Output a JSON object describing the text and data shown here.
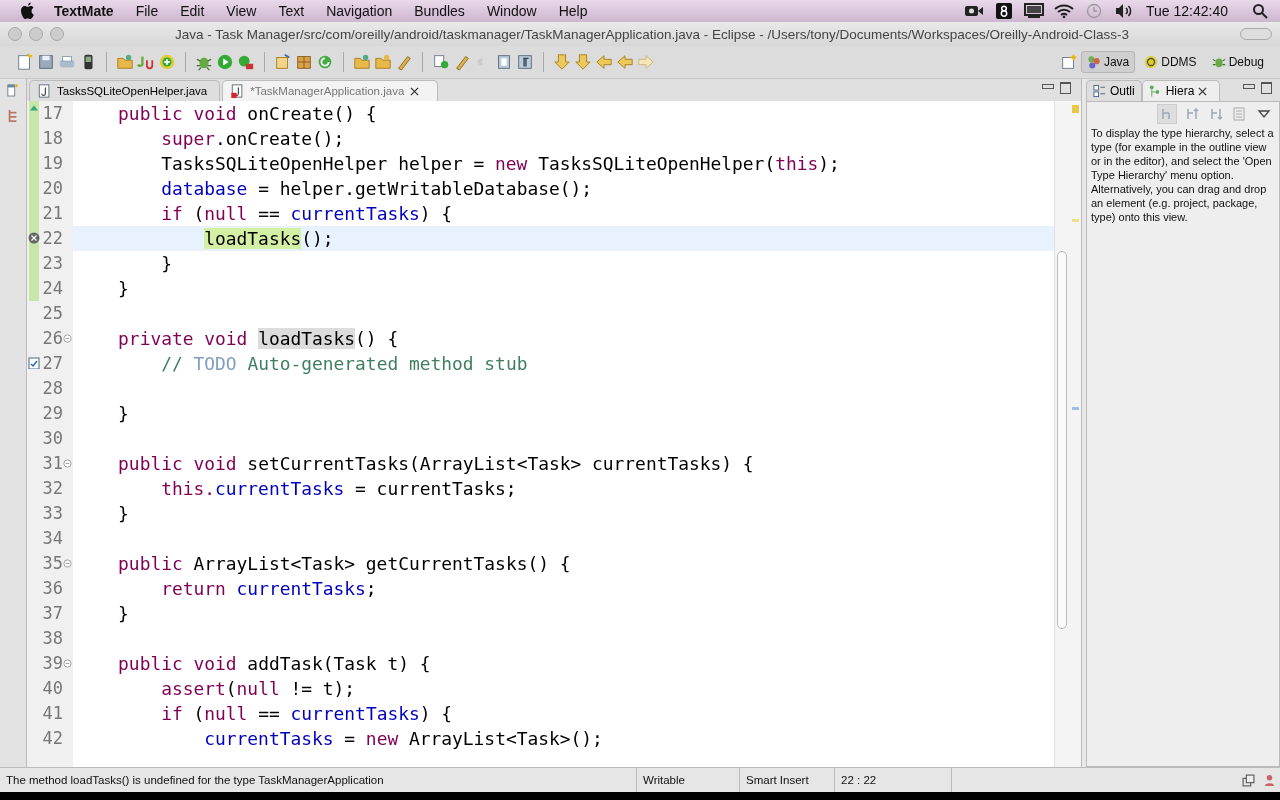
{
  "menu_bar": {
    "app": "TextMate",
    "items": [
      "File",
      "Edit",
      "View",
      "Text",
      "Navigation",
      "Bundles",
      "Window",
      "Help"
    ],
    "clock": "Tue 12:42:40"
  },
  "window": {
    "title": "Java - Task Manager/src/com/oreilly/android/taskmanager/TaskManagerApplication.java - Eclipse - /Users/tony/Documents/Workspaces/Oreilly-Android-Class-3"
  },
  "perspectives": [
    {
      "label": "Java",
      "selected": true
    },
    {
      "label": "DDMS",
      "selected": false
    },
    {
      "label": "Debug",
      "selected": false
    }
  ],
  "editor_tabs": [
    {
      "label": "TasksSQLiteOpenHelper.java",
      "selected": false,
      "closable": false,
      "error": false
    },
    {
      "label": "*TaskManagerApplication.java",
      "selected": true,
      "closable": true,
      "error": true
    }
  ],
  "editor_lines": [
    {
      "number": "17",
      "changed": true,
      "current": false,
      "deletion": true,
      "error": false,
      "task": false,
      "collapsible": false,
      "tokens": [
        {
          "text": "    public void",
          "kind": "keyword"
        },
        {
          "text": " onCreate() {",
          "kind": "plain"
        }
      ]
    },
    {
      "number": "18",
      "changed": true,
      "current": false,
      "deletion": false,
      "error": false,
      "task": false,
      "collapsible": false,
      "tokens": [
        {
          "text": "        super",
          "kind": "keyword"
        },
        {
          "text": ".onCreate();",
          "kind": "plain"
        }
      ]
    },
    {
      "number": "19",
      "changed": true,
      "current": false,
      "deletion": false,
      "error": false,
      "task": false,
      "collapsible": false,
      "tokens": [
        {
          "text": "        TasksSQLiteOpenHelper helper = ",
          "kind": "plain"
        },
        {
          "text": "new",
          "kind": "keyword"
        },
        {
          "text": " TasksSQLiteOpenHelper(",
          "kind": "plain"
        },
        {
          "text": "this",
          "kind": "keyword"
        },
        {
          "text": ");",
          "kind": "plain"
        }
      ]
    },
    {
      "number": "20",
      "changed": true,
      "current": false,
      "deletion": false,
      "error": false,
      "task": false,
      "collapsible": false,
      "tokens": [
        {
          "text": "        database",
          "kind": "field"
        },
        {
          "text": " = helper.getWritableDatabase();",
          "kind": "plain"
        }
      ]
    },
    {
      "number": "21",
      "changed": true,
      "current": false,
      "deletion": false,
      "error": false,
      "task": false,
      "collapsible": false,
      "tokens": [
        {
          "text": "        if",
          "kind": "keyword"
        },
        {
          "text": " (",
          "kind": "plain"
        },
        {
          "text": "null",
          "kind": "keyword"
        },
        {
          "text": " == ",
          "kind": "plain"
        },
        {
          "text": "currentTasks",
          "kind": "field"
        },
        {
          "text": ") {",
          "kind": "plain"
        }
      ]
    },
    {
      "number": "22",
      "changed": true,
      "current": true,
      "deletion": false,
      "error": true,
      "task": false,
      "collapsible": false,
      "tokens": [
        {
          "text": "            loadTasks",
          "kind": "read_occurrence"
        },
        {
          "text": "();",
          "kind": "plain"
        }
      ]
    },
    {
      "number": "23",
      "changed": true,
      "current": false,
      "deletion": false,
      "error": false,
      "task": false,
      "collapsible": false,
      "tokens": [
        {
          "text": "        }",
          "kind": "plain"
        }
      ]
    },
    {
      "number": "24",
      "changed": true,
      "current": false,
      "deletion": false,
      "error": false,
      "task": false,
      "collapsible": false,
      "tokens": [
        {
          "text": "    }",
          "kind": "plain"
        }
      ]
    },
    {
      "number": "25",
      "changed": false,
      "current": false,
      "deletion": false,
      "error": false,
      "task": false,
      "collapsible": false
    },
    {
      "number": "26",
      "changed": false,
      "current": false,
      "deletion": false,
      "error": false,
      "task": false,
      "collapsible": true,
      "tokens": [
        {
          "text": "    private void ",
          "kind": "keyword"
        },
        {
          "text": "loadTasks",
          "kind": "write_occurrence"
        },
        {
          "text": "() {",
          "kind": "plain"
        }
      ]
    },
    {
      "number": "27",
      "changed": false,
      "current": false,
      "deletion": false,
      "error": false,
      "task": true,
      "collapsible": false,
      "tokens": [
        {
          "text": "        // ",
          "kind": "comment"
        },
        {
          "text": "TODO",
          "kind": "todo"
        },
        {
          "text": " Auto-generated method stub",
          "kind": "comment"
        }
      ]
    },
    {
      "number": "28",
      "changed": false,
      "current": false,
      "deletion": false,
      "error": false,
      "task": false,
      "collapsible": false
    },
    {
      "number": "29",
      "changed": false,
      "current": false,
      "deletion": false,
      "error": false,
      "task": false,
      "collapsible": false,
      "tokens": [
        {
          "text": "    }",
          "kind": "plain"
        }
      ]
    },
    {
      "number": "30",
      "changed": false,
      "current": false,
      "deletion": false,
      "error": false,
      "task": false,
      "collapsible": false
    },
    {
      "number": "31",
      "changed": false,
      "current": false,
      "deletion": false,
      "error": false,
      "task": false,
      "collapsible": true,
      "tokens": [
        {
          "text": "    public void",
          "kind": "keyword"
        },
        {
          "text": " setCurrentTasks(ArrayList<Task> currentTasks) {",
          "kind": "plain"
        }
      ]
    },
    {
      "number": "32",
      "changed": false,
      "current": false,
      "deletion": false,
      "error": false,
      "task": false,
      "collapsible": false,
      "tokens": [
        {
          "text": "        this.",
          "kind": "keyword"
        },
        {
          "text": "currentTasks",
          "kind": "field"
        },
        {
          "text": " = currentTasks;",
          "kind": "plain"
        }
      ]
    },
    {
      "number": "33",
      "changed": false,
      "current": false,
      "deletion": false,
      "error": false,
      "task": false,
      "collapsible": false,
      "tokens": [
        {
          "text": "    }",
          "kind": "plain"
        }
      ]
    },
    {
      "number": "34",
      "changed": false,
      "current": false,
      "deletion": false,
      "error": false,
      "task": false,
      "collapsible": false
    },
    {
      "number": "35",
      "changed": false,
      "current": false,
      "deletion": false,
      "error": false,
      "task": false,
      "collapsible": true,
      "tokens": [
        {
          "text": "    public",
          "kind": "keyword"
        },
        {
          "text": " ArrayList<Task> getCurrentTasks() {",
          "kind": "plain"
        }
      ]
    },
    {
      "number": "36",
      "changed": false,
      "current": false,
      "deletion": false,
      "error": false,
      "task": false,
      "collapsible": false,
      "tokens": [
        {
          "text": "        return",
          "kind": "keyword"
        },
        {
          "text": " currentTasks",
          "kind": "field"
        },
        {
          "text": ";",
          "kind": "plain"
        }
      ]
    },
    {
      "number": "37",
      "changed": false,
      "current": false,
      "deletion": false,
      "error": false,
      "task": false,
      "collapsible": false,
      "tokens": [
        {
          "text": "    }",
          "kind": "plain"
        }
      ]
    },
    {
      "number": "38",
      "changed": false,
      "current": false,
      "deletion": false,
      "error": false,
      "task": false,
      "collapsible": false
    },
    {
      "number": "39",
      "changed": false,
      "current": false,
      "deletion": false,
      "error": false,
      "task": false,
      "collapsible": true,
      "tokens": [
        {
          "text": "    public void",
          "kind": "keyword"
        },
        {
          "text": " addTask(Task t) {",
          "kind": "plain"
        }
      ]
    },
    {
      "number": "40",
      "changed": false,
      "current": false,
      "deletion": false,
      "error": false,
      "task": false,
      "collapsible": false,
      "tokens": [
        {
          "text": "        assert",
          "kind": "keyword"
        },
        {
          "text": "(",
          "kind": "plain"
        },
        {
          "text": "null",
          "kind": "keyword"
        },
        {
          "text": " != t);",
          "kind": "plain"
        }
      ]
    },
    {
      "number": "41",
      "changed": false,
      "current": false,
      "deletion": false,
      "error": false,
      "task": false,
      "collapsible": false,
      "tokens": [
        {
          "text": "        if",
          "kind": "keyword"
        },
        {
          "text": " (",
          "kind": "plain"
        },
        {
          "text": "null",
          "kind": "keyword"
        },
        {
          "text": " == ",
          "kind": "plain"
        },
        {
          "text": "currentTasks",
          "kind": "field"
        },
        {
          "text": ") {",
          "kind": "plain"
        }
      ]
    },
    {
      "number": "42",
      "changed": false,
      "current": false,
      "deletion": false,
      "error": false,
      "task": false,
      "collapsible": false,
      "tokens": [
        {
          "text": "            currentTasks",
          "kind": "field"
        },
        {
          "text": " = ",
          "kind": "plain"
        },
        {
          "text": "new",
          "kind": "keyword"
        },
        {
          "text": " ArrayList<Task>();",
          "kind": "plain"
        }
      ]
    }
  ],
  "side_tabs": [
    {
      "label": "Outli",
      "selected": false,
      "closable": false
    },
    {
      "label": "Hiera",
      "selected": true,
      "closable": true
    }
  ],
  "hierarchy_message": "To display the type hierarchy, select a type (for example in the outline view or in the editor), and select the 'Open Type Hierarchy' menu option. Alternatively, you can drag and drop an element (e.g. project, package, type) onto this view.",
  "status_bar": {
    "message": "The method loadTasks() is undefined for the type TaskManagerApplication",
    "mode": "Writable",
    "insert_mode": "Smart Insert",
    "position": "22 : 22"
  }
}
